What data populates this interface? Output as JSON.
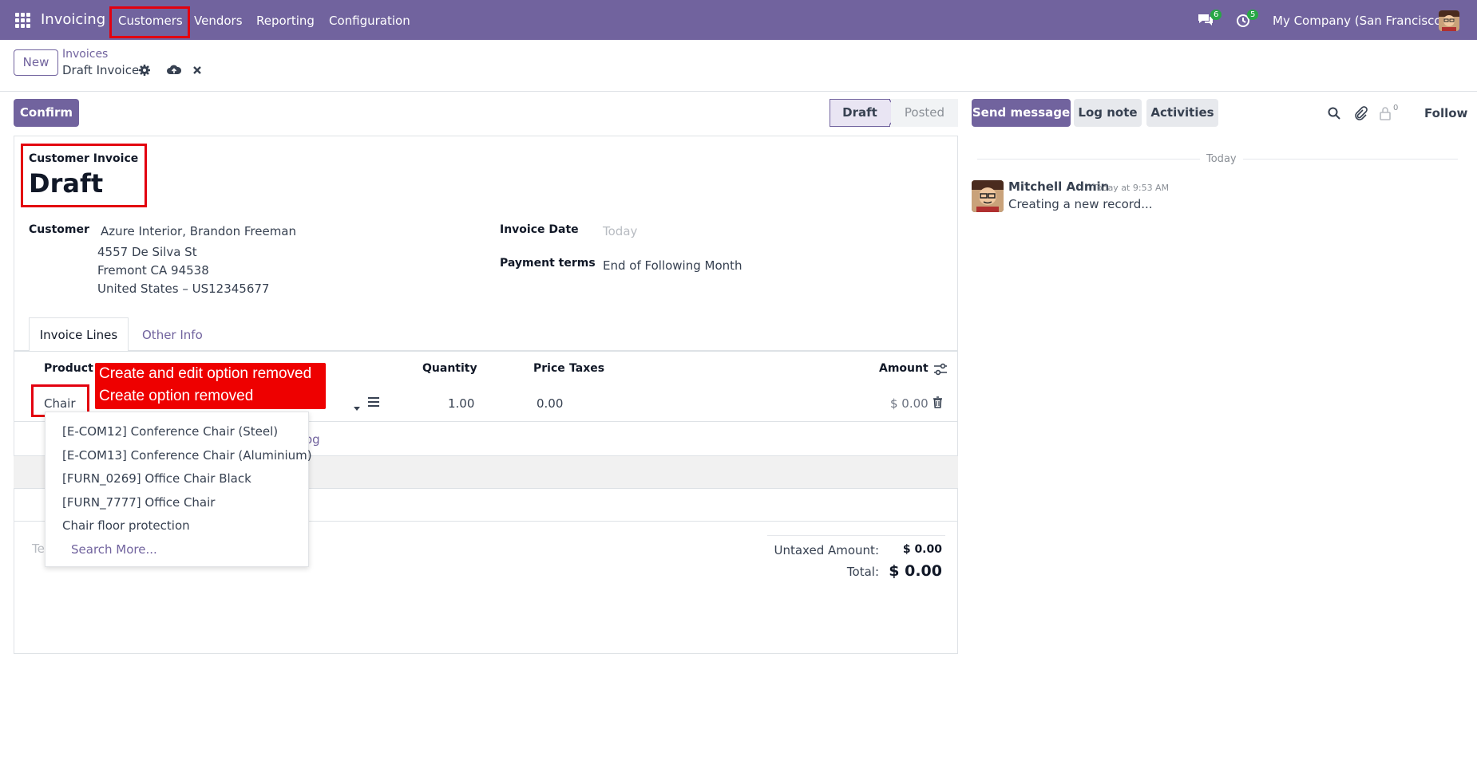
{
  "navbar": {
    "app_name": "Invoicing",
    "menu": [
      "Customers",
      "Vendors",
      "Reporting",
      "Configuration"
    ],
    "messages_badge": "6",
    "activities_badge": "5",
    "company": "My Company (San Francisco)"
  },
  "control_panel": {
    "new_label": "New",
    "breadcrumb_parent": "Invoices",
    "breadcrumb_current": "Draft Invoice"
  },
  "actions": {
    "confirm_label": "Confirm",
    "status_steps": [
      "Draft",
      "Posted"
    ],
    "status_active": "Draft"
  },
  "form": {
    "type_label": "Customer Invoice",
    "title": "Draft",
    "customer_label": "Customer",
    "customer_name": "Azure Interior, Brandon Freeman",
    "customer_address": [
      "4557 De Silva St",
      "Fremont CA 94538",
      "United States – US12345677"
    ],
    "invoice_date_label": "Invoice Date",
    "invoice_date_placeholder": "Today",
    "payment_terms_label": "Payment terms",
    "payment_terms_value": "End of Following Month",
    "tabs": [
      "Invoice Lines",
      "Other Info"
    ]
  },
  "lines": {
    "headers": {
      "product": "Product",
      "quantity": "Quantity",
      "price": "Price",
      "taxes": "Taxes",
      "amount": "Amount"
    },
    "row": {
      "product_input": "Chair",
      "quantity": "1.00",
      "price": "0.00",
      "amount": "$ 0.00"
    },
    "partial_link": "og",
    "terms_partial": "Te"
  },
  "annotation": {
    "line1": "Create and edit option removed",
    "line2": "Create option removed"
  },
  "dropdown": {
    "items": [
      "[E-COM12] Conference Chair (Steel)",
      "[E-COM13] Conference Chair (Aluminium)",
      "[FURN_0269] Office Chair Black",
      "[FURN_7777] Office Chair",
      "Chair floor protection"
    ],
    "search_more": "Search More..."
  },
  "totals": {
    "untaxed_label": "Untaxed Amount:",
    "untaxed_value": "$ 0.00",
    "total_label": "Total:",
    "total_value": "$ 0.00"
  },
  "chatter": {
    "send_message": "Send message",
    "log_note": "Log note",
    "activities": "Activities",
    "followers_count": "0",
    "follow": "Follow",
    "date_separator": "Today",
    "message": {
      "author": "Mitchell Admin",
      "time": "Today at 9:53 AM",
      "body": "Creating a new record..."
    }
  },
  "colors": {
    "brand": "#71639e",
    "annotation_red": "#ee0000",
    "badge_green": "#28a745"
  }
}
